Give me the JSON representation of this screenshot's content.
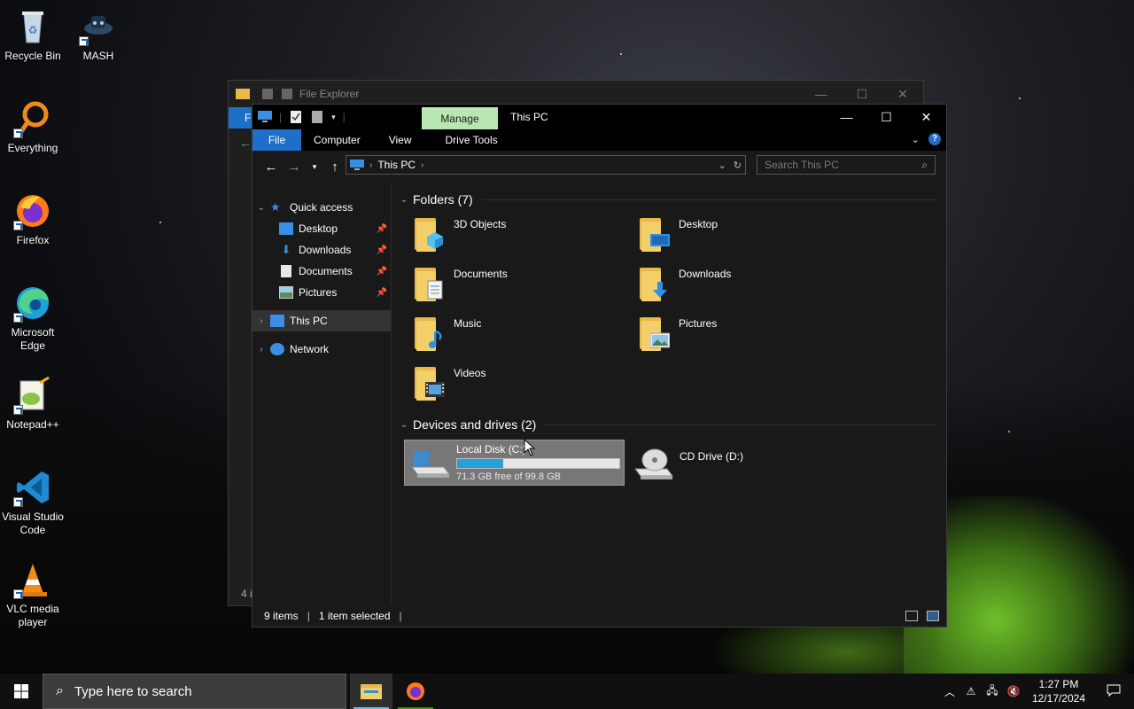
{
  "desktop": {
    "icons": [
      {
        "label": "Recycle Bin"
      },
      {
        "label": "MASH"
      },
      {
        "label": "Everything"
      },
      {
        "label": "Firefox"
      },
      {
        "label": "Microsoft Edge"
      },
      {
        "label": "Notepad++"
      },
      {
        "label": "Visual Studio Code"
      },
      {
        "label": "VLC media player"
      }
    ]
  },
  "background_window": {
    "title": "File Explorer",
    "tab_file": "F",
    "status_fragment": "4 i"
  },
  "window": {
    "title": "This PC",
    "manage_tab": "Manage",
    "ribbon": {
      "file": "File",
      "tabs": [
        "Computer",
        "View",
        "Drive Tools"
      ]
    },
    "address": {
      "root": "This PC"
    },
    "search_placeholder": "Search This PC",
    "nav": {
      "quick_access": "Quick access",
      "pinned": [
        "Desktop",
        "Downloads",
        "Documents",
        "Pictures"
      ],
      "this_pc": "This PC",
      "network": "Network"
    },
    "folders_heading": "Folders (7)",
    "folders": [
      "3D Objects",
      "Desktop",
      "Documents",
      "Downloads",
      "Music",
      "Pictures",
      "Videos"
    ],
    "drives_heading": "Devices and drives (2)",
    "drives": [
      {
        "name": "Local Disk (C:)",
        "free": "71.3 GB free of 99.8 GB",
        "used_fraction": 0.286
      },
      {
        "name": "CD Drive (D:)"
      }
    ],
    "status": {
      "items": "9 items",
      "selected": "1 item selected"
    }
  },
  "taskbar": {
    "search_placeholder": "Type here to search",
    "time": "1:27 PM",
    "date": "12/17/2024"
  },
  "colors": {
    "accent": "#1e6fc7",
    "manage_tab": "#b9e7b1",
    "drive_bar": "#26a0da",
    "folder": "#f3cf6a"
  }
}
